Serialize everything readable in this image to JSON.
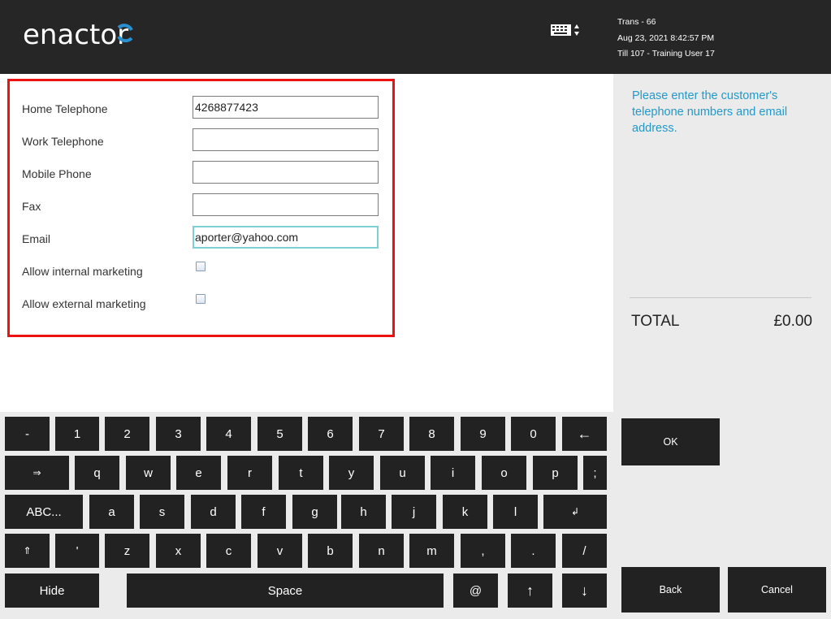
{
  "header": {
    "logo_text": "enactor",
    "keyboard_toggle_icon": "keyboard-toggle-icon",
    "trans": "Trans - 66",
    "datetime": "Aug 23, 2021 8:42:57 PM",
    "till": "Till 107 - Training User 17"
  },
  "form": {
    "fields": [
      {
        "label": "Home Telephone",
        "value": "4268877423"
      },
      {
        "label": "Work Telephone",
        "value": ""
      },
      {
        "label": "Mobile Phone",
        "value": ""
      },
      {
        "label": "Fax",
        "value": ""
      },
      {
        "label": "Email",
        "value": "aporter@yahoo.com"
      }
    ],
    "checkboxes": [
      {
        "label": "Allow internal marketing",
        "checked": false
      },
      {
        "label": "Allow external marketing",
        "checked": false
      }
    ],
    "highlight_color": "#ee1111",
    "focus_color": "#7fd0d4"
  },
  "side": {
    "prompt": "Please enter the customer's telephone numbers and email address.",
    "total_label": "TOTAL",
    "total_value": "£0.00",
    "prompt_color": "#2299c9"
  },
  "keyboard": {
    "row1": [
      "-",
      "1",
      "2",
      "3",
      "4",
      "5",
      "6",
      "7",
      "8",
      "9",
      "0",
      "←"
    ],
    "row2": [
      "⇒",
      "q",
      "w",
      "e",
      "r",
      "t",
      "y",
      "u",
      "i",
      "o",
      "p",
      ";"
    ],
    "row3": [
      "ABC...",
      "a",
      "s",
      "d",
      "f",
      "g",
      "h",
      "j",
      "k",
      "l",
      "↲"
    ],
    "row4": [
      "⇑",
      "'",
      "z",
      "x",
      "c",
      "v",
      "b",
      "n",
      "m",
      ",",
      ".",
      "/"
    ],
    "row5": [
      "Hide",
      "Space",
      "@",
      "↑",
      "↓"
    ]
  },
  "actions": {
    "ok": "OK",
    "back": "Back",
    "cancel": "Cancel"
  }
}
